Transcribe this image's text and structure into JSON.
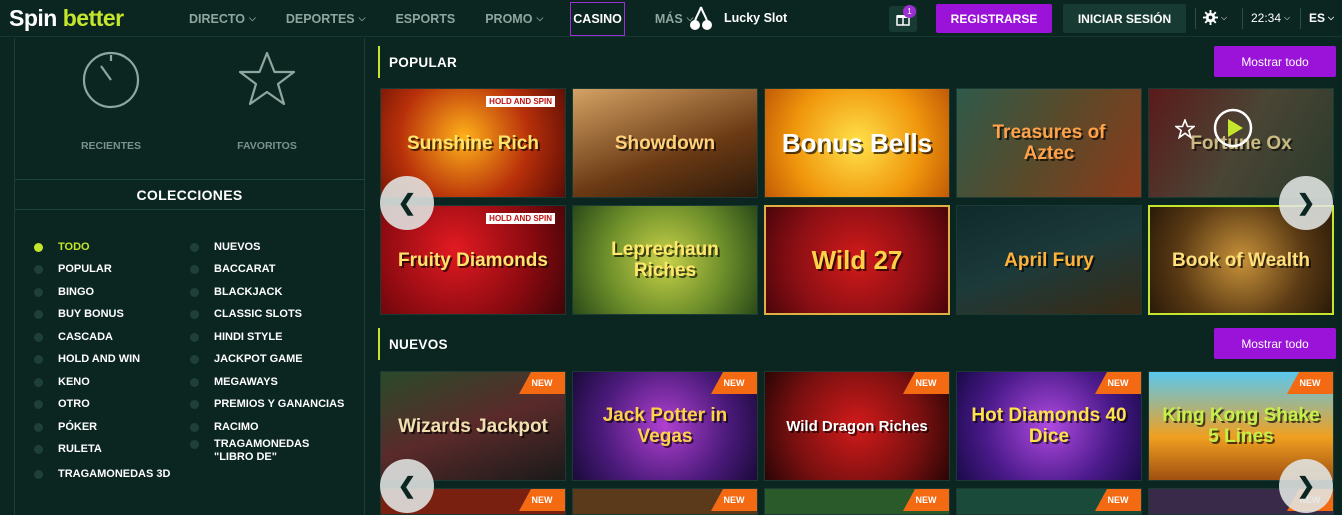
{
  "header": {
    "logo_part1": "Spin",
    "logo_part2": "better",
    "nav": [
      "DIRECTO",
      "DEPORTES",
      "ESPORTS",
      "PROMO",
      "CASINO",
      "MÁS"
    ],
    "lucky_slot": "Lucky Slot",
    "gift_badge": "1",
    "register": "REGISTRARSE",
    "login": "INICIAR SESIÓN",
    "time": "22:34",
    "lang": "ES"
  },
  "sidebar": {
    "recent": "RECIENTES",
    "favorites": "FAVORITOS",
    "collections_title": "COLECCIONES",
    "collections_left": [
      "TODO",
      "POPULAR",
      "BINGO",
      "BUY BONUS",
      "CASCADA",
      "HOLD AND WIN",
      "KENO",
      "OTRO",
      "PÓKER",
      "RULETA",
      "TRAGAMONEDAS 3D"
    ],
    "collections_right": [
      "NUEVOS",
      "BACCARAT",
      "BLACKJACK",
      "CLASSIC SLOTS",
      "HINDI STYLE",
      "JACKPOT GAME",
      "MEGAWAYS",
      "PREMIOS Y GANANCIAS",
      "RACIMO",
      "TRAGAMONEDAS \"LIBRO DE\""
    ]
  },
  "popular": {
    "title": "POPULAR",
    "show_all": "Mostrar todo",
    "games": [
      {
        "name": "Sunshine Rich",
        "tag": "HOLD AND SPIN",
        "bg": "#8a1b05"
      },
      {
        "name": "Showdown",
        "tag": "",
        "bg": "#6b3a14"
      },
      {
        "name": "Bonus Bells",
        "tag": "",
        "bg": "#e08a10"
      },
      {
        "name": "Treasures of Aztec",
        "tag": "",
        "bg": "#3f3a2a"
      },
      {
        "name": "Fortune Ox",
        "tag": "",
        "bg": "#4a4535"
      },
      {
        "name": "Fruity Diamonds",
        "tag": "HOLD AND SPIN",
        "bg": "#9c0f14"
      },
      {
        "name": "Leprechaun Riches",
        "tag": "",
        "bg": "#6e8f2a"
      },
      {
        "name": "Wild 27",
        "tag": "",
        "bg": "#8a0f14"
      },
      {
        "name": "April Fury",
        "tag": "",
        "bg": "#1d3a3a"
      },
      {
        "name": "Book of Wealth",
        "tag": "",
        "bg": "#5a3a14"
      }
    ]
  },
  "new": {
    "title": "NUEVOS",
    "show_all": "Mostrar todo",
    "new_label": "NEW",
    "games": [
      {
        "name": "Wizards Jackpot",
        "bg": "#3a2a2a"
      },
      {
        "name": "Jack Potter in Vegas",
        "bg": "#4a1a7a"
      },
      {
        "name": "Wild Dragon Riches",
        "bg": "#7a1010"
      },
      {
        "name": "Hot Diamonds 40 Dice",
        "bg": "#4a1a8a"
      },
      {
        "name": "King Kong Shake 5 Lines",
        "bg": "#e07a10"
      }
    ]
  }
}
